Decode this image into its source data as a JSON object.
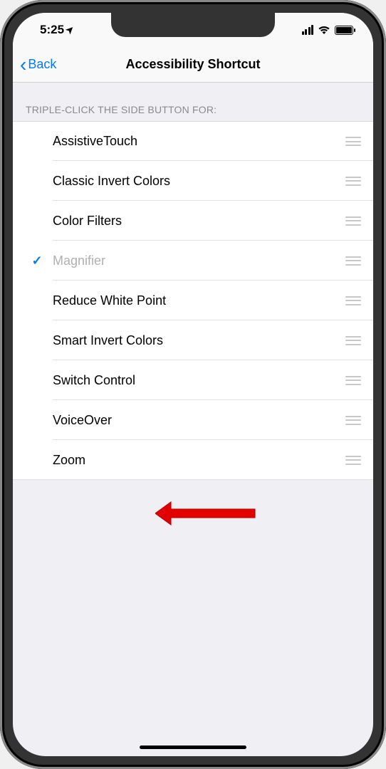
{
  "statusbar": {
    "time": "5:25",
    "location_arrow": "➤"
  },
  "nav": {
    "back_label": "Back",
    "title": "Accessibility Shortcut"
  },
  "section_header": "TRIPLE-CLICK THE SIDE BUTTON FOR:",
  "rows": [
    {
      "label": "AssistiveTouch",
      "selected": false
    },
    {
      "label": "Classic Invert Colors",
      "selected": false
    },
    {
      "label": "Color Filters",
      "selected": false
    },
    {
      "label": "Magnifier",
      "selected": true
    },
    {
      "label": "Reduce White Point",
      "selected": false
    },
    {
      "label": "Smart Invert Colors",
      "selected": false
    },
    {
      "label": "Switch Control",
      "selected": false
    },
    {
      "label": "VoiceOver",
      "selected": false
    },
    {
      "label": "Zoom",
      "selected": false
    }
  ],
  "annotation": {
    "arrow_target": "Zoom"
  }
}
